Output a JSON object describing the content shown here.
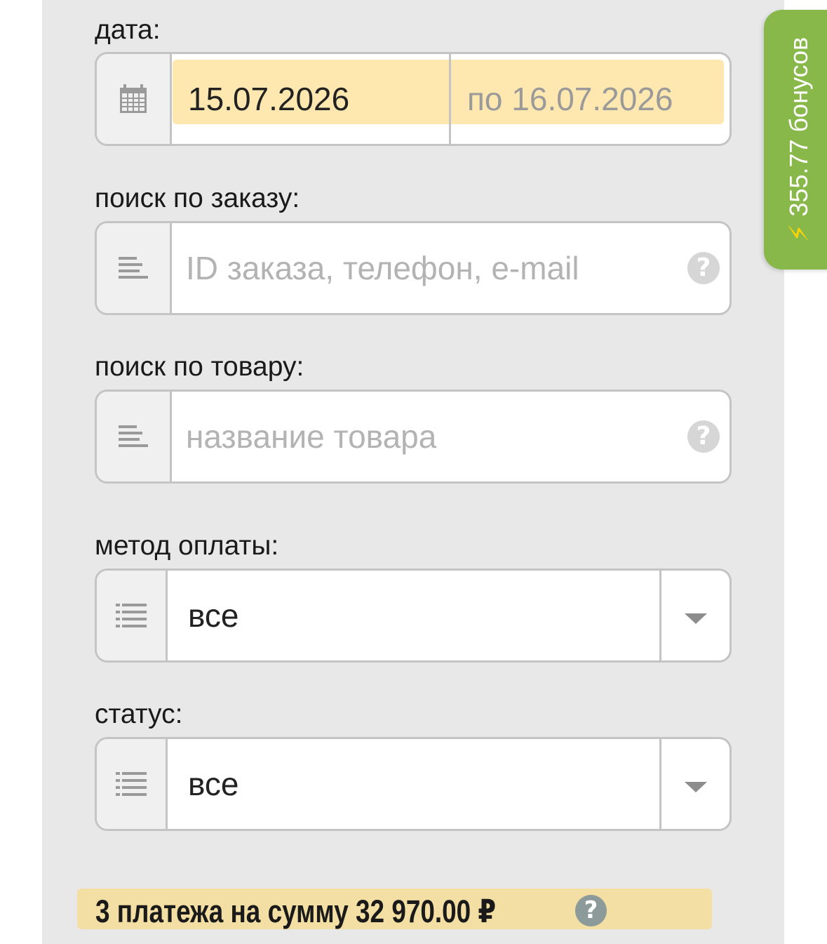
{
  "filters": {
    "date": {
      "label": "дата:",
      "from_value": "15.07.2026",
      "to_value": "по 16.07.2026",
      "icon": "calendar-icon"
    },
    "order_search": {
      "label": "поиск по заказу:",
      "placeholder": "ID заказа, телефон, e-mail",
      "icon": "text-lines-icon",
      "help_icon": "question-icon"
    },
    "product_search": {
      "label": "поиск по товару:",
      "placeholder": "название товара",
      "icon": "text-lines-icon",
      "help_icon": "question-icon"
    },
    "payment_method": {
      "label": "метод оплаты:",
      "selected": "все",
      "icon": "list-icon"
    },
    "status": {
      "label": "статус:",
      "selected": "все",
      "icon": "list-icon"
    }
  },
  "bonus_tab": {
    "text": "355.77 бонусов",
    "icon": "lightning-icon",
    "color": "#88b84a"
  },
  "summary": {
    "text": "3 платежа на сумму 32 970.00 ₽",
    "help_icon": "question-icon"
  }
}
